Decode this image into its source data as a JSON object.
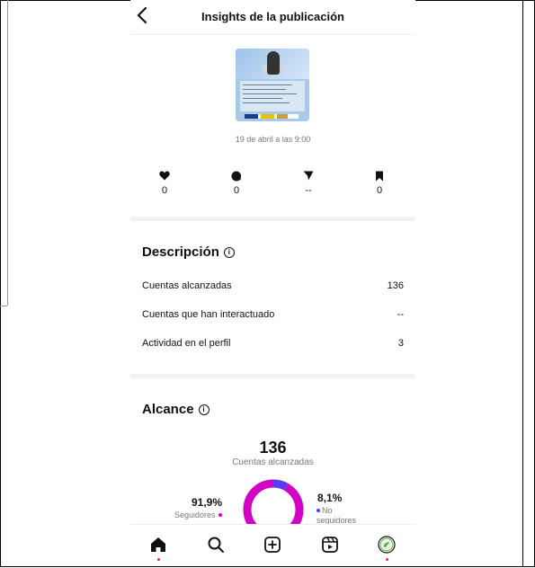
{
  "header": {
    "back_icon": "chevron-left-icon",
    "title": "Insights de la publicación"
  },
  "post": {
    "date": "19 de abril a las 9:00"
  },
  "stats": [
    {
      "icon": "heart-icon",
      "value": "0"
    },
    {
      "icon": "comment-icon",
      "value": "0"
    },
    {
      "icon": "share-icon",
      "value": "--"
    },
    {
      "icon": "bookmark-icon",
      "value": "0"
    }
  ],
  "description": {
    "title": "Descripción",
    "rows": [
      {
        "label": "Cuentas alcanzadas",
        "value": "136"
      },
      {
        "label": "Cuentas que han interactuado",
        "value": "--"
      },
      {
        "label": "Actividad en el perfil",
        "value": "3"
      }
    ]
  },
  "reach": {
    "title": "Alcance",
    "count": "136",
    "count_label": "Cuentas alcanzadas",
    "followers_pct": "91,9%",
    "followers_label": "Seguidores",
    "non_followers_pct": "8,1%",
    "non_followers_label_1": "No",
    "non_followers_label_2": "seguidores",
    "followers_share": 0.919,
    "followers_color": "#d300c5",
    "non_followers_color": "#5b3cf0"
  },
  "tabbar": [
    "home-icon",
    "search-icon",
    "create-icon",
    "reels-icon",
    "profile-avatar-icon"
  ],
  "accent": "#e0245e"
}
